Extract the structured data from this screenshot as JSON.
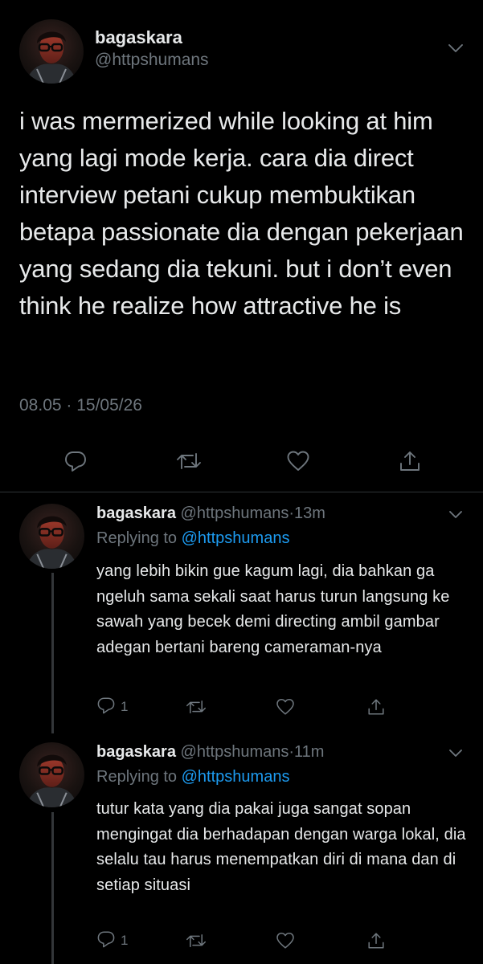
{
  "main_tweet": {
    "display_name": "bagaskara",
    "handle": "@httpshumans",
    "text": "i was mermerized while looking at him yang lagi mode kerja. cara dia direct interview petani cukup membuktikan betapa passionate dia dengan pekerjaan yang sedang dia tekuni. but i don’t even think he realize how attractive he is",
    "timestamp": "08.05 · 15/05/26",
    "actions": [
      "reply-icon",
      "retweet-icon",
      "like-icon",
      "share-icon"
    ]
  },
  "replies": [
    {
      "display_name": "bagaskara",
      "handle": "@httpshumans",
      "time": "13m",
      "replying_label": "Replying to",
      "replying_to": "@httpshumans",
      "text": "yang lebih bikin gue kagum lagi, dia bahkan ga ngeluh sama sekali saat harus turun langsung ke sawah yang becek demi directing ambil gambar adegan bertani bareng cameraman-nya",
      "reply_count": "1"
    },
    {
      "display_name": "bagaskara",
      "handle": "@httpshumans",
      "time": "11m",
      "replying_label": "Replying to",
      "replying_to": "@httpshumans",
      "text": "tutur kata yang dia pakai juga sangat sopan mengingat dia berhadapan dengan warga lokal, dia selalu tau harus menempatkan diri di mana dan di setiap situasi",
      "reply_count": "1"
    }
  ],
  "colors": {
    "background": "#000000",
    "text": "#e7e9ea",
    "muted": "#6e767d",
    "link": "#1d9bf0",
    "divider": "#2f3336"
  }
}
